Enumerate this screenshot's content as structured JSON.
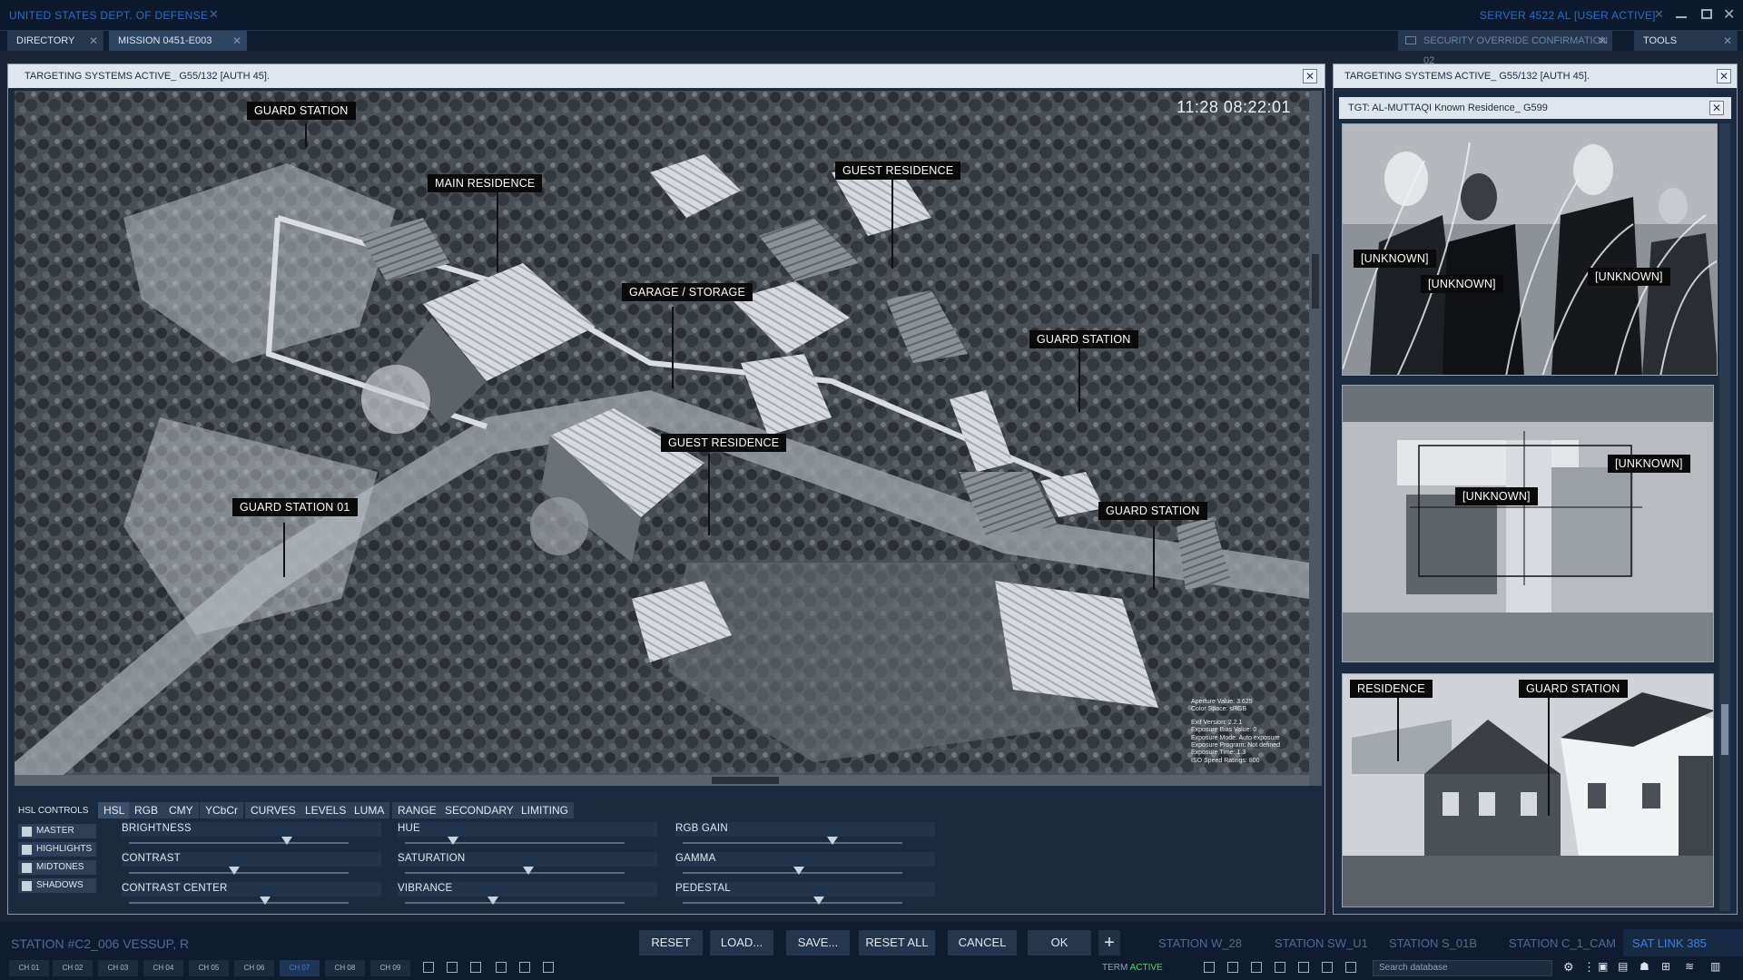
{
  "window": {
    "title": "UNITED STATES DEPT. OF DEFENSE",
    "server": "SERVER 4522 AL [USER ACTIVE]"
  },
  "tabs": [
    {
      "label": "DIRECTORY"
    },
    {
      "label": "MISSION 0451-E003"
    }
  ],
  "right_tabs": [
    {
      "label": "SECURITY OVERRIDE CONFIRMATION 02"
    },
    {
      "label": "TOOLS"
    }
  ],
  "main_panel": {
    "header": "TARGETING SYSTEMS ACTIVE_ G55/132 [AUTH 45].",
    "timestamp": "11:28 08:22:01",
    "labels": [
      "GUARD STATION",
      "MAIN RESIDENCE",
      "GUEST RESIDENCE",
      "GARAGE / STORAGE",
      "GUARD STATION",
      "GUEST RESIDENCE",
      "GUARD STATION 01",
      "GUARD STATION"
    ],
    "exif": [
      "Aperture Value: 3.625",
      "Color Space: sRGB",
      "Exif Version: 2.2.1",
      "Exposure Bias Value: 0",
      "Exposure Mode: Auto exposure",
      "Exposure Program: Not defined",
      "Exposure Time: 1.3",
      "ISO Speed Ratings: 800"
    ]
  },
  "controls": {
    "title": "HSL CONTROLS",
    "tabs": [
      "HSL",
      "RGB",
      "CMY",
      "YCbCr",
      "CURVES",
      "LEVELS",
      "LUMA",
      "RANGE",
      "SECONDARY",
      "LIMITING"
    ],
    "ranges": [
      "MASTER",
      "HIGHLIGHTS",
      "MIDTONES",
      "SHADOWS"
    ],
    "sliders_col1": [
      {
        "label": "BRIGHTNESS",
        "value": 0.72
      },
      {
        "label": "CONTRAST",
        "value": 0.48
      },
      {
        "label": "CONTRAST CENTER",
        "value": 0.62
      }
    ],
    "sliders_col2": [
      {
        "label": "HUE",
        "value": 0.22
      },
      {
        "label": "SATURATION",
        "value": 0.56
      },
      {
        "label": "VIBRANCE",
        "value": 0.4
      }
    ],
    "sliders_col3": [
      {
        "label": "RGB GAIN",
        "value": 0.68
      },
      {
        "label": "GAMMA",
        "value": 0.53
      },
      {
        "label": "PEDESTAL",
        "value": 0.62
      }
    ]
  },
  "side_panel": {
    "header": "TARGETING SYSTEMS ACTIVE_ G55/132 [AUTH 45].",
    "target": "TGT: AL-MUTTAQI Known Residence_ G599",
    "thumb1_labels": [
      "[UNKNOWN]",
      "[UNKNOWN]",
      "[UNKNOWN]"
    ],
    "thumb2_labels": [
      "[UNKNOWN]",
      "[UNKNOWN]"
    ],
    "thumb3_labels": [
      "RESIDENCE",
      "GUARD STATION"
    ]
  },
  "bottom": {
    "station_id": "STATION #C2_006  VESSUP, R",
    "buttons": [
      "RESET",
      "LOAD...",
      "SAVE...",
      "RESET ALL",
      "CANCEL",
      "OK"
    ],
    "stations": [
      "STATION W_28",
      "STATION SW_U1",
      "STATION S_01B",
      "STATION C_1_CAM"
    ],
    "sat_link": "SAT LINK 385",
    "channels": [
      "CH 01",
      "CH 02",
      "CH 03",
      "CH 04",
      "CH 05",
      "CH 06",
      "CH 07",
      "CH 08",
      "CH 09"
    ],
    "term_label": "TERM",
    "term_status": "ACTIVE",
    "search_placeholder": "Search database"
  },
  "colors": {
    "accent_blue": "#2d6ec0",
    "term_active": "#4fd36a",
    "sat_link": "#3b80e0"
  }
}
